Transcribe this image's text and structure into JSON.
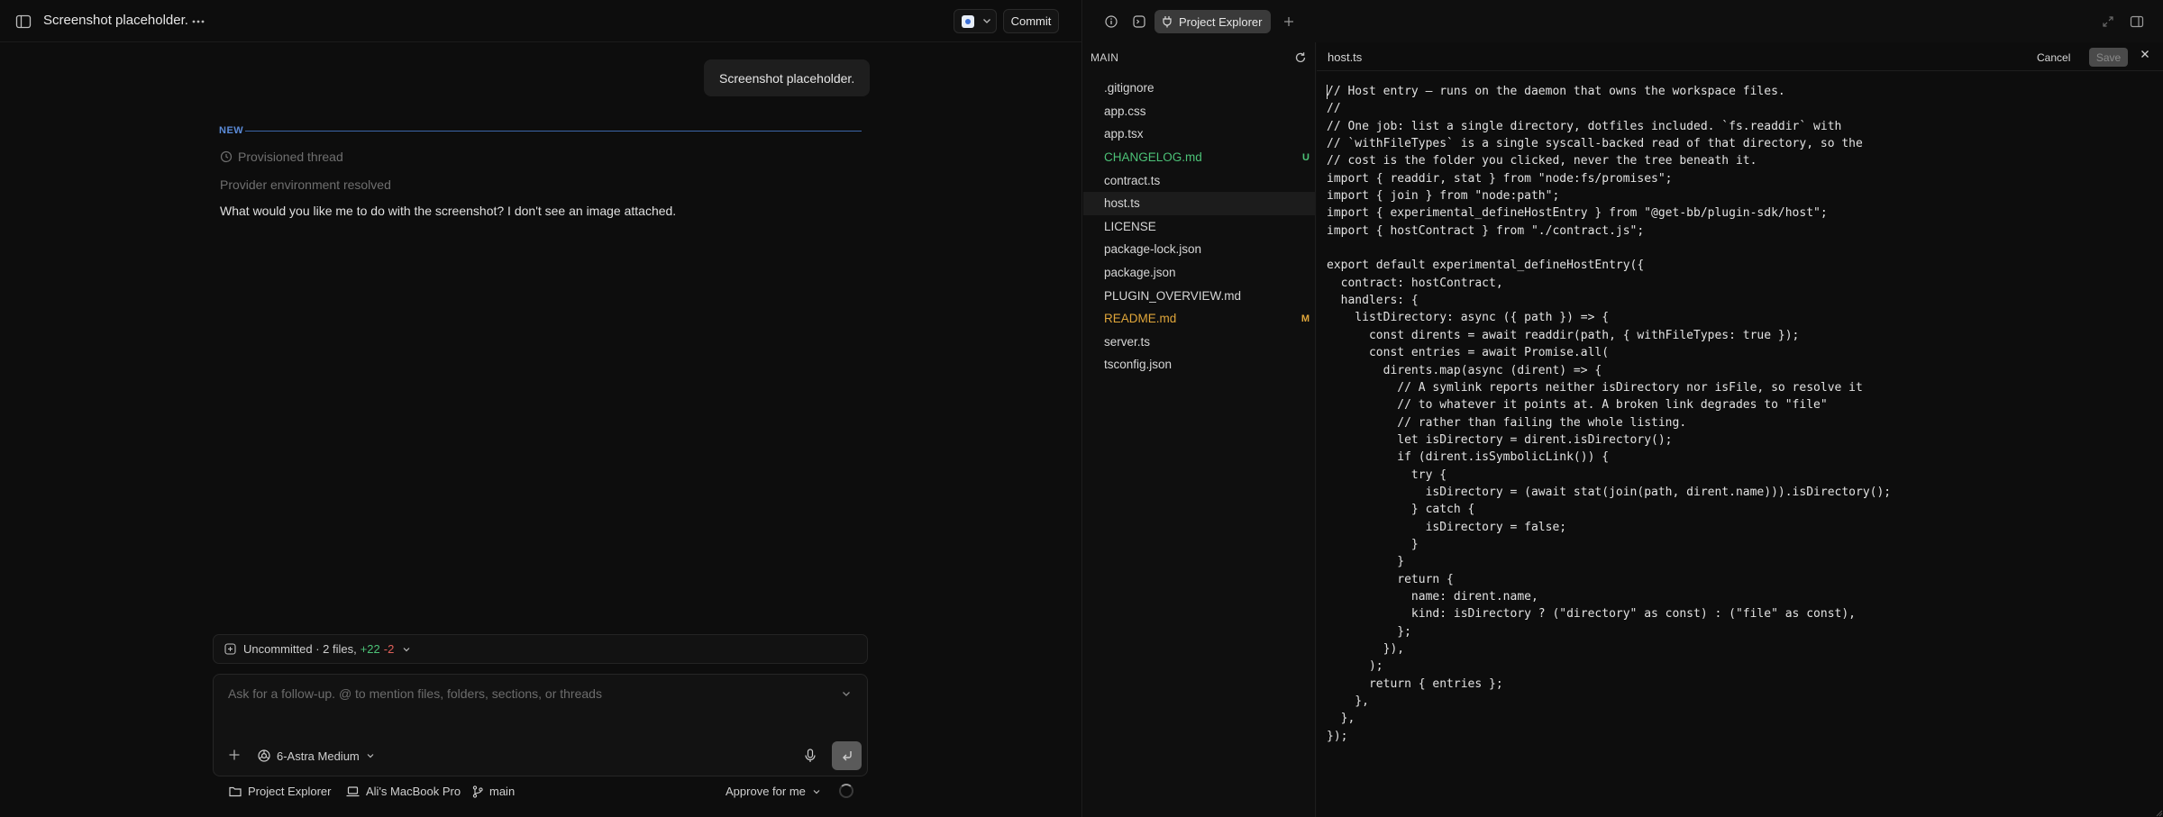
{
  "chat": {
    "title": "Screenshot placeholder.",
    "commit_label": "Commit",
    "user_message": "Screenshot placeholder.",
    "new_label": "NEW",
    "status_provisioned": "Provisioned thread",
    "status_provider": "Provider environment resolved",
    "assistant_message": "What would you like me to do with the screenshot? I don't see an image attached.",
    "uncommitted": {
      "label": "Uncommitted · 2 files,",
      "additions": "+22",
      "deletions": "-2"
    },
    "composer": {
      "placeholder": "Ask for a follow-up. @ to mention files, folders, sections, or threads",
      "model": "6-Astra Medium"
    },
    "footer": {
      "project": "Project Explorer",
      "machine": "Ali's MacBook Pro",
      "branch": "main",
      "approval": "Approve for me"
    }
  },
  "right": {
    "tab_label": "Project Explorer",
    "explorer_title": "MAIN",
    "files": [
      {
        "name": ".gitignore",
        "color": "#d6d6d6",
        "badge": ""
      },
      {
        "name": "app.css",
        "color": "#d6d6d6",
        "badge": ""
      },
      {
        "name": "app.tsx",
        "color": "#d6d6d6",
        "badge": ""
      },
      {
        "name": "CHANGELOG.md",
        "color": "#4cc277",
        "badge": "U",
        "badge_color": "#4cc277"
      },
      {
        "name": "contract.ts",
        "color": "#d6d6d6",
        "badge": ""
      },
      {
        "name": "host.ts",
        "color": "#d6d6d6",
        "badge": "",
        "active": true
      },
      {
        "name": "LICENSE",
        "color": "#d6d6d6",
        "badge": ""
      },
      {
        "name": "package-lock.json",
        "color": "#d6d6d6",
        "badge": ""
      },
      {
        "name": "package.json",
        "color": "#d6d6d6",
        "badge": ""
      },
      {
        "name": "PLUGIN_OVERVIEW.md",
        "color": "#d6d6d6",
        "badge": ""
      },
      {
        "name": "README.md",
        "color": "#e0a63a",
        "badge": "M",
        "badge_color": "#e0a63a"
      },
      {
        "name": "server.ts",
        "color": "#d6d6d6",
        "badge": ""
      },
      {
        "name": "tsconfig.json",
        "color": "#d6d6d6",
        "badge": ""
      }
    ],
    "editor": {
      "file_name": "host.ts",
      "cancel_label": "Cancel",
      "save_label": "Save",
      "code_lines": [
        "// Host entry — runs on the daemon that owns the workspace files.",
        "//",
        "// One job: list a single directory, dotfiles included. `fs.readdir` with",
        "// `withFileTypes` is a single syscall-backed read of that directory, so the",
        "// cost is the folder you clicked, never the tree beneath it.",
        "import { readdir, stat } from \"node:fs/promises\";",
        "import { join } from \"node:path\";",
        "import { experimental_defineHostEntry } from \"@get-bb/plugin-sdk/host\";",
        "import { hostContract } from \"./contract.js\";",
        "",
        "export default experimental_defineHostEntry({",
        "  contract: hostContract,",
        "  handlers: {",
        "    listDirectory: async ({ path }) => {",
        "      const dirents = await readdir(path, { withFileTypes: true });",
        "      const entries = await Promise.all(",
        "        dirents.map(async (dirent) => {",
        "          // A symlink reports neither isDirectory nor isFile, so resolve it",
        "          // to whatever it points at. A broken link degrades to \"file\"",
        "          // rather than failing the whole listing.",
        "          let isDirectory = dirent.isDirectory();",
        "          if (dirent.isSymbolicLink()) {",
        "            try {",
        "              isDirectory = (await stat(join(path, dirent.name))).isDirectory();",
        "            } catch {",
        "              isDirectory = false;",
        "            }",
        "          }",
        "          return {",
        "            name: dirent.name,",
        "            kind: isDirectory ? (\"directory\" as const) : (\"file\" as const),",
        "          };",
        "        }),",
        "      );",
        "      return { entries };",
        "    },",
        "  },",
        "});"
      ]
    }
  },
  "icons": {
    "sidebar_toggle": "sidebar-toggle-icon",
    "more": "more-horizontal-icon",
    "info": "info-icon",
    "terminal": "terminal-icon",
    "plug": "plug-icon",
    "add_tab": "plus-icon",
    "expand": "expand-icon",
    "panel": "panel-right-icon",
    "refresh": "refresh-icon"
  }
}
